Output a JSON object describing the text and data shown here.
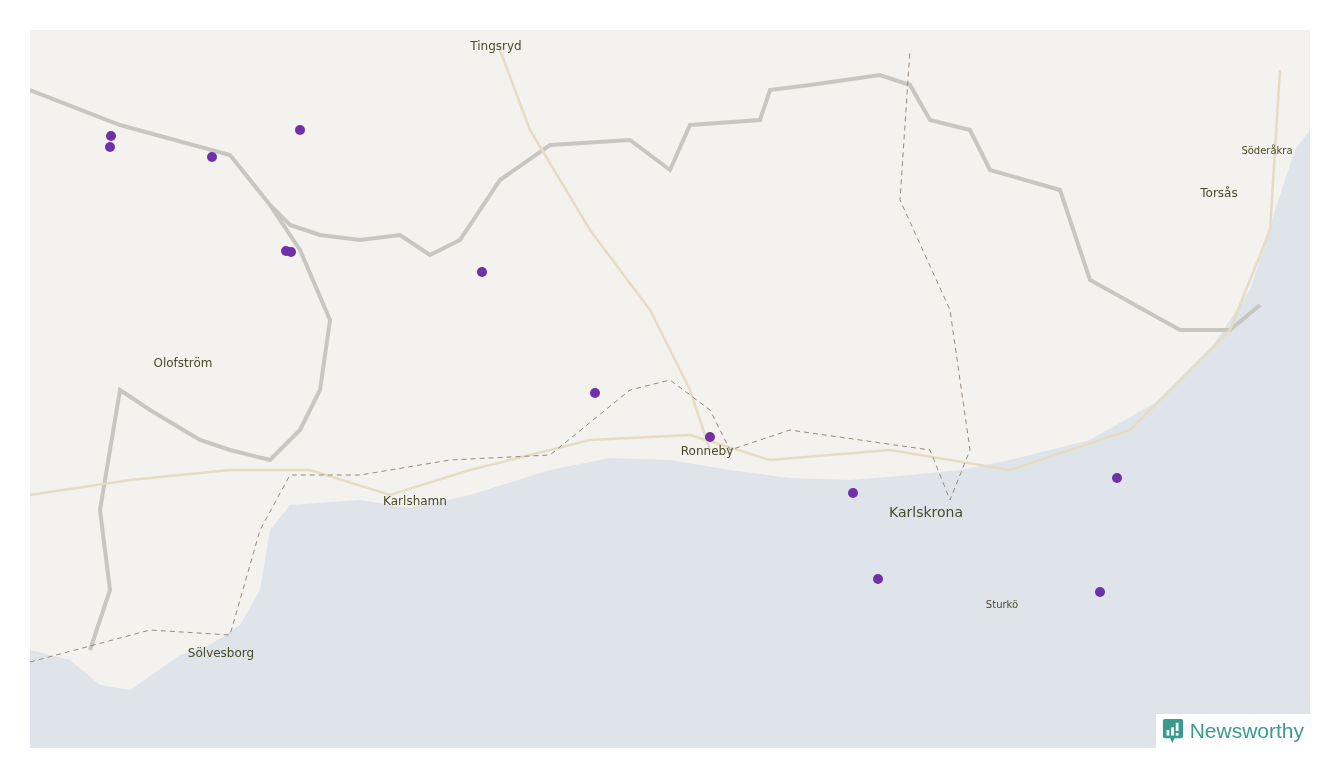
{
  "map": {
    "places": [
      {
        "name": "Tingsryd",
        "kind": "town"
      },
      {
        "name": "Söderåkra",
        "kind": "village"
      },
      {
        "name": "Torsås",
        "kind": "town"
      },
      {
        "name": "Olofström",
        "kind": "town"
      },
      {
        "name": "Ronneby",
        "kind": "town"
      },
      {
        "name": "Karlshamn",
        "kind": "town"
      },
      {
        "name": "Karlskrona",
        "kind": "city"
      },
      {
        "name": "Sturkö",
        "kind": "village"
      },
      {
        "name": "Sölvesborg",
        "kind": "town"
      }
    ],
    "markers": [
      {
        "color": "#7030a8"
      },
      {
        "color": "#7030a8"
      },
      {
        "color": "#7030a8"
      },
      {
        "color": "#7030a8"
      },
      {
        "color": "#7030a8"
      },
      {
        "color": "#7030a8"
      },
      {
        "color": "#7030a8"
      },
      {
        "color": "#7030a8"
      },
      {
        "color": "#7030a8"
      },
      {
        "color": "#7030a8"
      },
      {
        "color": "#7030a8"
      },
      {
        "color": "#7030a8"
      },
      {
        "color": "#7030a8"
      }
    ]
  },
  "logo": {
    "text": "Newsworthy"
  }
}
